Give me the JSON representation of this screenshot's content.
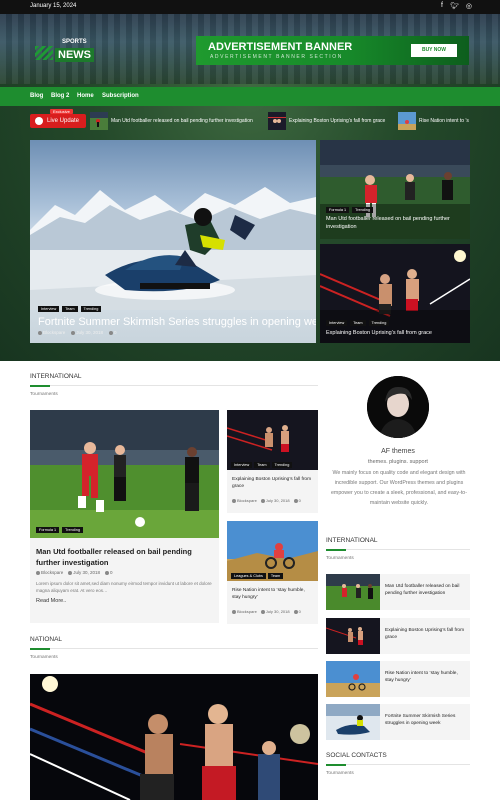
{
  "topbar": {
    "date": "January 15, 2024",
    "social": [
      "f",
      "t",
      "ig"
    ]
  },
  "logo": {
    "small": "SPORTS",
    "big": "NEWS"
  },
  "ad": {
    "title": "ADVERTISEMENT BANNER",
    "subtitle": "ADVERTISEMENT BANNER SECTION",
    "button": "BUY NOW"
  },
  "nav": [
    "Blog",
    "Blog 2",
    "Home",
    "Subscription"
  ],
  "ticker": {
    "exclusive": "Exclusive",
    "live": "Live Update",
    "items": [
      "Man Utd footballer released on bail pending further investigation",
      "Explaining Boston Uprising’s fall from grace",
      "Rise Nation intent to ’s"
    ]
  },
  "featured": {
    "tags": [
      "Interview",
      "Team",
      "Trending"
    ],
    "title": "Fortnite Summer Skirmish Series struggles in opening week",
    "author": "Blockspare",
    "date": "July 30, 2018",
    "comments": "0"
  },
  "side_cards": [
    {
      "tags": [
        "Formula 1",
        "Trending"
      ],
      "title": "Man Utd footballer released on bail pending further investigation"
    },
    {
      "tags": [
        "Interview",
        "Team",
        "Trending"
      ],
      "title": "Explaining Boston Uprising’s fall from grace"
    }
  ],
  "international": {
    "label": "INTERNATIONAL",
    "sub": "Tournaments",
    "big_card": {
      "tags": [
        "Formula 1",
        "Trending"
      ],
      "title": "Man Utd footballer released on bail pending further investigation",
      "author": "Blockspare",
      "date": "July 30, 2018",
      "comments": "0",
      "excerpt": "Lorem ipsum dolor sit amet,sed diam nonumy eirmod tempor invidunt ut labore et dolore magna aliquyam erat. At vero eos…",
      "more": "Read More.."
    },
    "small_cards": [
      {
        "tags": [
          "Interview",
          "Team",
          "Trending"
        ],
        "title": "Explaining Boston Uprising’s fall from grace",
        "author": "Blockspare",
        "date": "July 30, 2018",
        "comments": "0"
      },
      {
        "tags": [
          "Leagues & Clubs",
          "Team"
        ],
        "title": "Rise Nation intent to ‘stay humble, stay hungry’",
        "author": "Blockspare",
        "date": "July 30, 2018",
        "comments": "0"
      }
    ]
  },
  "national": {
    "label": "NATIONAL",
    "sub": "Tournaments"
  },
  "author": {
    "name": "AF themes",
    "tagline": "themes. plugins. support",
    "bio": "We mainly focus on quality code and elegant design with incredible support. Our WordPress themes and plugins empower you to create a sleek, professional, and easy-to-maintain website quickly."
  },
  "sidebar_international": {
    "label": "INTERNATIONAL",
    "sub": "Tournaments",
    "items": [
      "Man Utd footballer released on bail pending further investigation",
      "Explaining Boston Uprising’s fall from grace",
      "Rise Nation intent to ‘stay humble, stay hungry’",
      "Fortnite Summer Skirmish Series struggles in opening week"
    ]
  },
  "social_contacts": {
    "label": "SOCIAL CONTACTS",
    "sub": "Tournaments"
  },
  "colors": {
    "brand_green": "#1e8d2f",
    "live_red": "#d81e1e",
    "topbar": "#111111"
  }
}
